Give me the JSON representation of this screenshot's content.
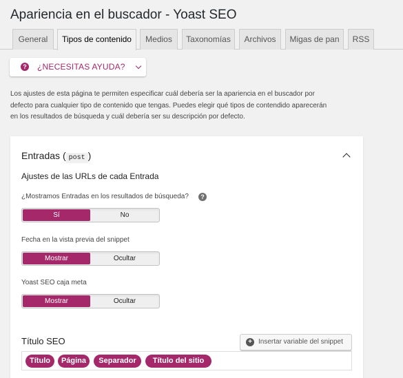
{
  "page": {
    "title": "Apariencia en el buscador - Yoast SEO"
  },
  "tabs": [
    {
      "label": "General"
    },
    {
      "label": "Tipos de contenido",
      "active": true
    },
    {
      "label": "Medios"
    },
    {
      "label": "Taxonomías"
    },
    {
      "label": "Archivos"
    },
    {
      "label": "Migas de pan"
    },
    {
      "label": "RSS"
    }
  ],
  "help": {
    "label": "¿NECESITAS AYUDA?",
    "icon": "question-icon"
  },
  "intro": {
    "line1": "Los ajustes de esta página te permiten especificar cuál debería ser la apariencia en el buscador por",
    "line2": "defecto para cualquier tipo de contenido que tengas. Puedes elegir qué tipos de contendido aparecerán",
    "line3": "en los resultados de búsqueda y cuál debería ser su descripción por defecto."
  },
  "card": {
    "title": "Entradas",
    "paren_open": "(",
    "post_type": "post",
    "paren_close": ")",
    "section_title": "Ajustes de las URLs de cada Entrada",
    "show_in_results": {
      "label_prefix": "¿Mostramos ",
      "label_bold": "Entradas",
      "label_suffix": " en los resultados de búsqueda?",
      "on": "Sí",
      "off": "No"
    },
    "date_snippet": {
      "label": "Fecha en la vista previa del snippet",
      "on": "Mostrar",
      "off": "Ocultar"
    },
    "meta_box": {
      "label": "Yoast SEO caja meta",
      "on": "Mostrar",
      "off": "Ocultar"
    },
    "seo_title": {
      "label": "Título SEO",
      "insert_button": "Insertar variable del snippet",
      "variables": [
        "Título",
        "Página",
        "Separador",
        "Título del sitio"
      ]
    }
  },
  "colors": {
    "accent": "#a4286a",
    "background": "#f1f1f1"
  }
}
